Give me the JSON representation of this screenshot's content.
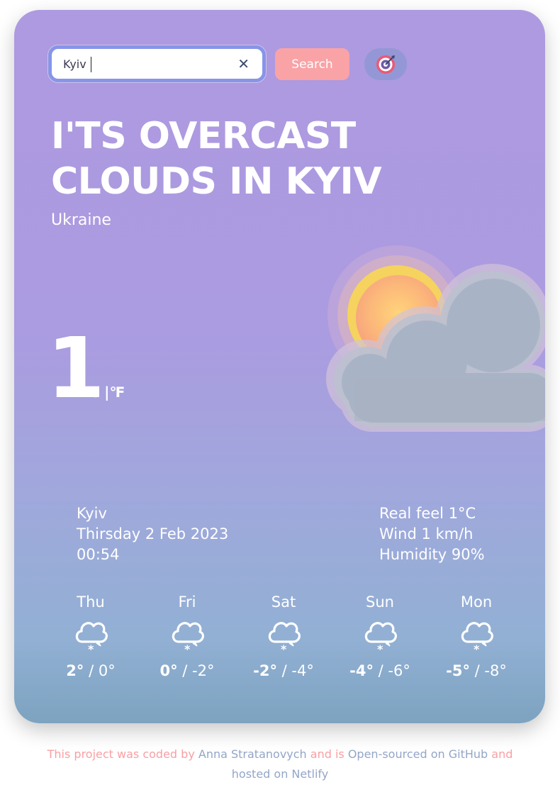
{
  "search": {
    "value": "Kyiv",
    "clear_icon": "close-icon",
    "button_label": "Search",
    "location_icon": "target-icon"
  },
  "current": {
    "headline": "I'TS OVERCAST CLOUDS IN KYIV",
    "country": "Ukraine",
    "temperature": "1",
    "unit_c": "℃",
    "unit_sep": " |",
    "unit_f": "℉",
    "icon": "sun-behind-cloud-icon"
  },
  "details": {
    "city": "Kyiv",
    "date": "Thirsday 2 Feb 2023",
    "time": "00:54",
    "real_feel": "Real feel 1°C",
    "wind": "Wind 1 km/h",
    "humidity": "Humidity 90%"
  },
  "forecast": [
    {
      "day": "Thu",
      "max": "2°",
      "sep": " / ",
      "min": "0°",
      "icon": "snow-cloud-icon"
    },
    {
      "day": "Fri",
      "max": "0°",
      "sep": " / ",
      "min": "-2°",
      "icon": "snow-cloud-icon"
    },
    {
      "day": "Sat",
      "max": "-2°",
      "sep": " / ",
      "min": "-4°",
      "icon": "snow-cloud-icon"
    },
    {
      "day": "Sun",
      "max": "-4°",
      "sep": " / ",
      "min": "-6°",
      "icon": "snow-cloud-icon"
    },
    {
      "day": "Mon",
      "max": "-5°",
      "sep": " / ",
      "min": "-8°",
      "icon": "snow-cloud-icon"
    }
  ],
  "footer": {
    "t1": "This project was coded by ",
    "author": "Anna Stratanovych",
    "t2": " and is ",
    "github": "Open-sourced on GitHub",
    "t3": " and",
    "netlify": "hosted on Netlify"
  },
  "colors": {
    "accent_pink": "#f9a3a7",
    "search_border": "#8795e8",
    "link_blue": "#93a6c8"
  }
}
